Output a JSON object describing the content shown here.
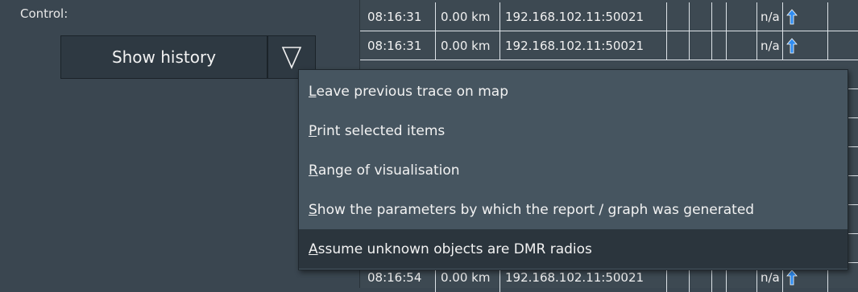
{
  "control": {
    "label": "Control:",
    "show_history_label": "Show history",
    "dropdown_icon": "triangle-down-outline-icon"
  },
  "table": {
    "top_rows": [
      {
        "time": "08:16:31",
        "distance": "0.00 km",
        "address": "192.168.102.11:50021",
        "status": "n/a",
        "icon": "up-arrow-icon"
      },
      {
        "time": "08:16:31",
        "distance": "0.00 km",
        "address": "192.168.102.11:50021",
        "status": "n/a",
        "icon": "up-arrow-icon"
      }
    ],
    "bottom_rows": [
      {
        "time": "08:16:54",
        "distance": "0.00 km",
        "address": "192.168.102.11:50021",
        "status": "n/a",
        "icon": "up-arrow-icon"
      }
    ],
    "arrow_color": "#2f8cf0"
  },
  "menu": {
    "items": [
      {
        "mnemonic": "L",
        "rest": "eave previous trace on map"
      },
      {
        "mnemonic": "P",
        "rest": "rint selected items"
      },
      {
        "mnemonic": "R",
        "rest": "ange of visualisation"
      },
      {
        "mnemonic": "S",
        "rest": "how the parameters by which the report / graph was generated"
      },
      {
        "mnemonic": "A",
        "rest": "ssume unknown objects are DMR radios"
      }
    ],
    "highlighted_index": 4
  }
}
